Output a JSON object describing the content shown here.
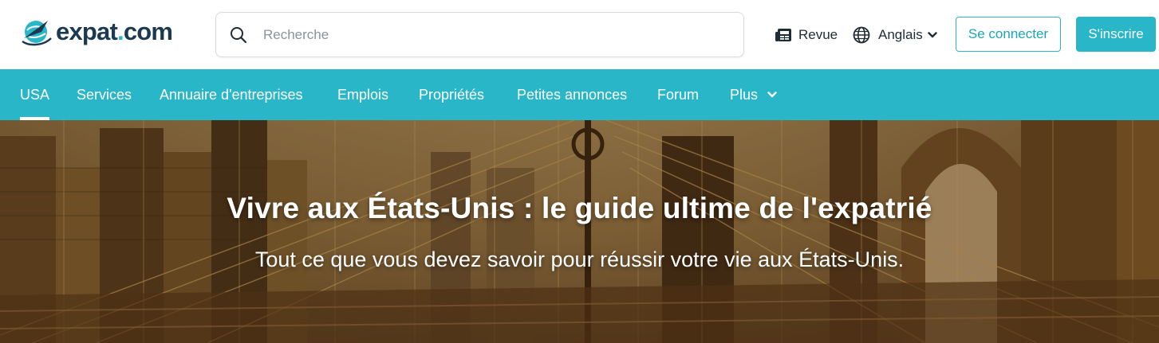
{
  "brand": {
    "name_part1": "expat",
    "name_dot": ".",
    "name_part2": "com",
    "logo_icon": "globe-plane-logo",
    "accent": "#29b6c8",
    "dark": "#1b3a52"
  },
  "search": {
    "placeholder": "Recherche",
    "value": ""
  },
  "header": {
    "review_label": "Revue",
    "review_icon": "newspaper-icon",
    "language_label": "Anglais",
    "language_icon": "globe-icon",
    "login_label": "Se connecter",
    "signup_label": "S'inscrire"
  },
  "nav": {
    "items": [
      {
        "label": "USA",
        "active": true
      },
      {
        "label": "Services",
        "active": false
      },
      {
        "label": "Annuaire d'entreprises",
        "active": false
      },
      {
        "label": "Emplois",
        "active": false
      },
      {
        "label": "Propriétés",
        "active": false
      },
      {
        "label": "Petites annonces",
        "active": false
      },
      {
        "label": "Forum",
        "active": false
      },
      {
        "label": "Plus",
        "active": false
      }
    ],
    "background": "#29b6c8"
  },
  "hero": {
    "title": "Vivre aux États-Unis : le guide ultime de l'expatrié",
    "subtitle": "Tout ce que vous devez savoir pour réussir votre vie aux États-Unis.",
    "image": "brooklyn-bridge-photo"
  }
}
